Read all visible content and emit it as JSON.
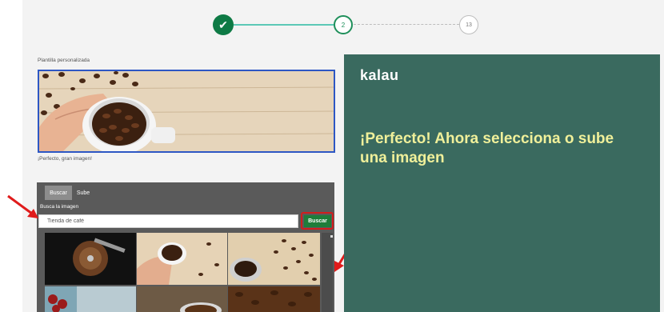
{
  "stepper": {
    "step1_icon": "check-icon",
    "step1_symbol": "✔",
    "step2_label": "2",
    "step3_label": "13"
  },
  "left": {
    "template_label": "Plantilla personalizada",
    "preview_caption": "¡Perfecto, gran imagen!"
  },
  "search_panel": {
    "tabs": [
      {
        "label": "Buscar",
        "active": true
      },
      {
        "label": "Sube",
        "active": false
      }
    ],
    "title": "Busca la imagen",
    "input_value": "Tienda de café",
    "button_label": "Buscar",
    "thumbnails": [
      {
        "icon": "coffee-grinder-image"
      },
      {
        "icon": "coffee-cup-hand-image"
      },
      {
        "icon": "coffee-beans-cup-image"
      },
      {
        "icon": "coffee-cherries-image"
      },
      {
        "icon": "coffee-mug-image"
      },
      {
        "icon": "coffee-beans-texture-image"
      }
    ]
  },
  "right_panel": {
    "brand": "kalau",
    "headline": "¡Perfecto! Ahora selecciona o sube una imagen"
  },
  "colors": {
    "accent_green": "#0e7a45",
    "panel_green": "#3a6a5f",
    "headline_yellow": "#f0f09a",
    "highlight_red": "#d21d1d",
    "selection_blue": "#2d57c4"
  }
}
